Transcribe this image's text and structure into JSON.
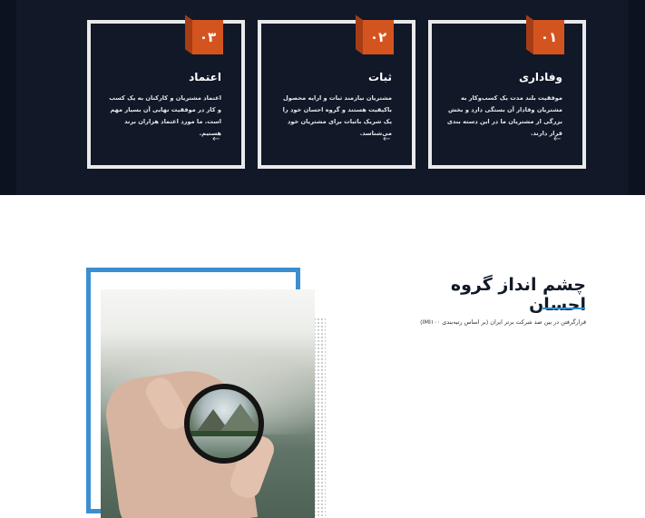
{
  "cards": [
    {
      "number": "۰۳",
      "title": "اعتماد",
      "text": "اعتماد مشتریان و کارکنان به یک کسب و کار در موفقیت نهایی آن بسیار مهم است. ما مورد اعتماد هزاران برند هستیم.",
      "arrow": "←"
    },
    {
      "number": "۰۲",
      "title": "ثبات",
      "text": "مشتریان نیازمند ثبات و ارایه محصول باکیفیت هستند و گروه احسان خود را یک شریک باثبات برای مشتریان خود می‌شناسد.",
      "arrow": "←"
    },
    {
      "number": "۰۱",
      "title": "وفاداری",
      "text": "موفقیت بلند مدت یک کسب‌وکار به مشتریان وفادار آن بستگی دارد و بخش بزرگی از مشتریان ما در این دسته بندی قرار دارند.",
      "arrow": "←"
    }
  ],
  "vision": {
    "title": "چشم انداز گروه احسان",
    "text": "قرارگرفتن در بین صد شرکت برتر ایران (بر اساس رتبه‌بندی IMI۱۰۰)"
  },
  "colors": {
    "dark_band": "#111827",
    "badge": "#d4541f",
    "accent_blue": "#3b8fd0"
  }
}
